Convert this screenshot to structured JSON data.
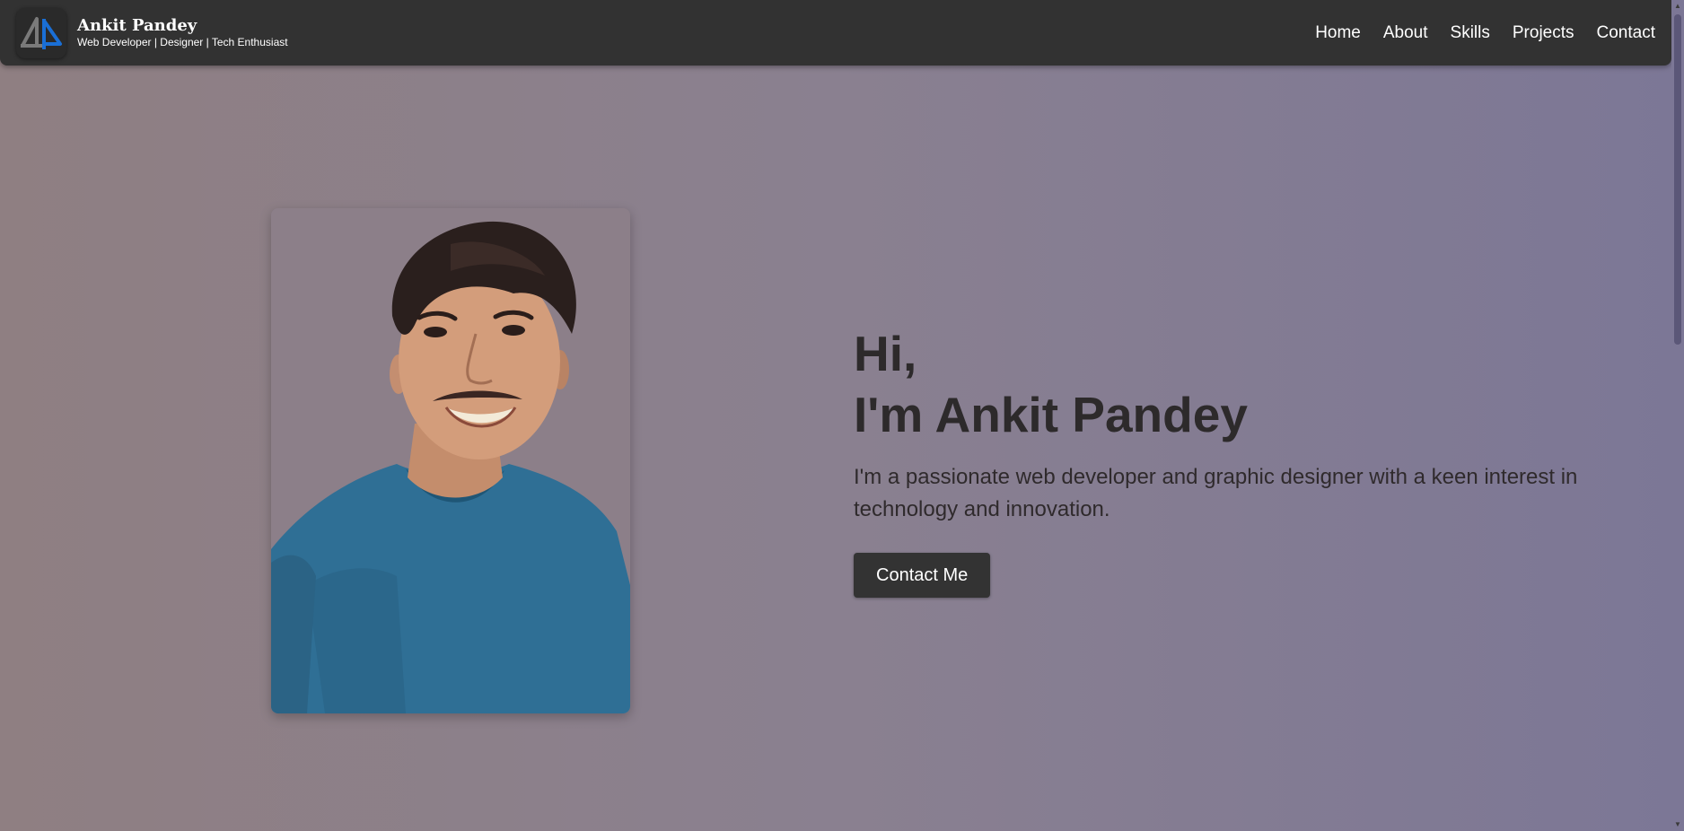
{
  "brand": {
    "name": "Ankit Pandey",
    "tagline": "Web Developer | Designer | Tech Enthusiast",
    "logo_icon": "ap-monogram-logo"
  },
  "nav": {
    "items": [
      {
        "label": "Home"
      },
      {
        "label": "About"
      },
      {
        "label": "Skills"
      },
      {
        "label": "Projects"
      },
      {
        "label": "Contact"
      }
    ]
  },
  "hero": {
    "greeting": "Hi,",
    "headline": "I'm Ankit Pandey",
    "description": "I'm a passionate web developer and graphic designer with a keen interest in technology and innovation.",
    "cta_label": "Contact Me",
    "photo_icon": "profile-photo"
  },
  "colors": {
    "navbar_bg": "#323232",
    "accent_blue": "#1a6fd6",
    "button_bg": "#333333",
    "text_dark": "#2d2a2b"
  }
}
